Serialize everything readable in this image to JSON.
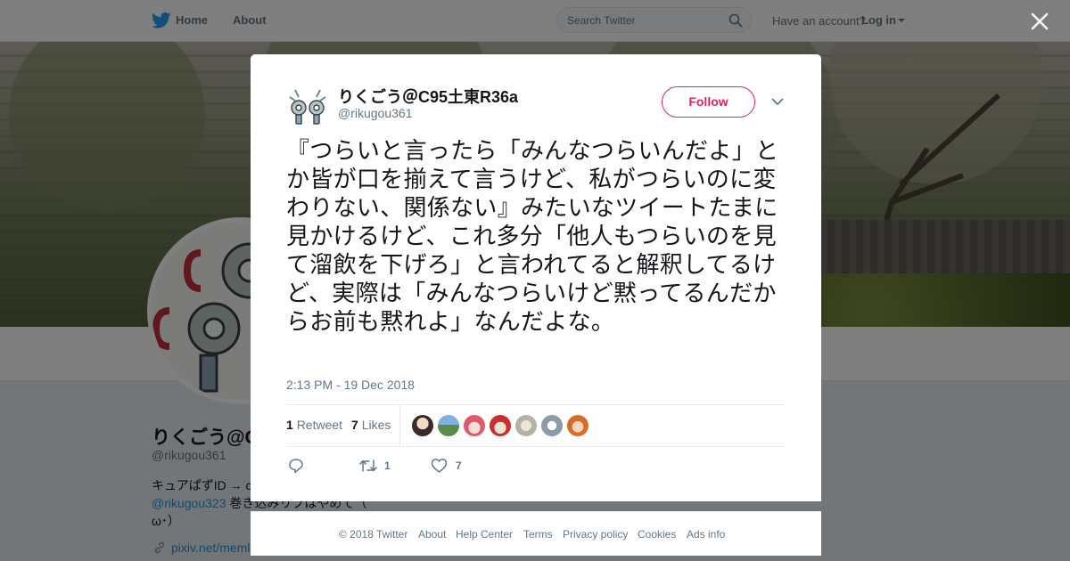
{
  "nav": {
    "home_label": "Home",
    "about_label": "About",
    "search_placeholder": "Search Twitter",
    "have_account": "Have an account?",
    "login_label": "Log in"
  },
  "profile": {
    "name_partial": "りくごう@C",
    "handle": "@rikugou361",
    "bio_line1": "キュアぱずID → c",
    "bio_mention": "@rikugou323",
    "bio_line2_rest": " 巻き込みリプはやめて（",
    "bio_line3": "ω･）",
    "link": "pixiv.net/meml"
  },
  "tweet": {
    "author_name": "りくごう＠C95土東R36a",
    "author_handle": "@rikugou361",
    "follow_label": "Follow",
    "text": "『つらいと言ったら「みんなつらいんだよ」とか皆が口を揃えて言うけど、私がつらいのに変わりない、関係ない』みたいなツイートたまに見かけるけど、これ多分「他人もつらいのを見て溜飲を下げろ」と言われてると解釈してるけど、実際は「みんなつらいけど黙ってるんだからお前も黙れよ」なんだよな。",
    "timestamp": "2:13 PM - 19 Dec 2018",
    "retweet_count": "1",
    "retweet_label": "Retweet",
    "like_count": "7",
    "like_label": "Likes",
    "action_retweet_count": "1",
    "action_like_count": "7"
  },
  "footer": {
    "copyright": "© 2018 Twitter",
    "about": "About",
    "help": "Help Center",
    "terms": "Terms",
    "privacy": "Privacy policy",
    "cookies": "Cookies",
    "ads": "Ads info"
  },
  "icons": {
    "logo": "twitter-bird-icon",
    "search": "search-icon",
    "close": "close-icon",
    "caret": "caret-down-icon",
    "reply": "reply-icon",
    "retweet": "retweet-icon",
    "like": "heart-icon",
    "link": "link-icon"
  },
  "colors": {
    "brand_blue": "#1da1f2",
    "follow_red": "#e0245e",
    "text_primary": "#14171a",
    "text_secondary": "#657786"
  }
}
